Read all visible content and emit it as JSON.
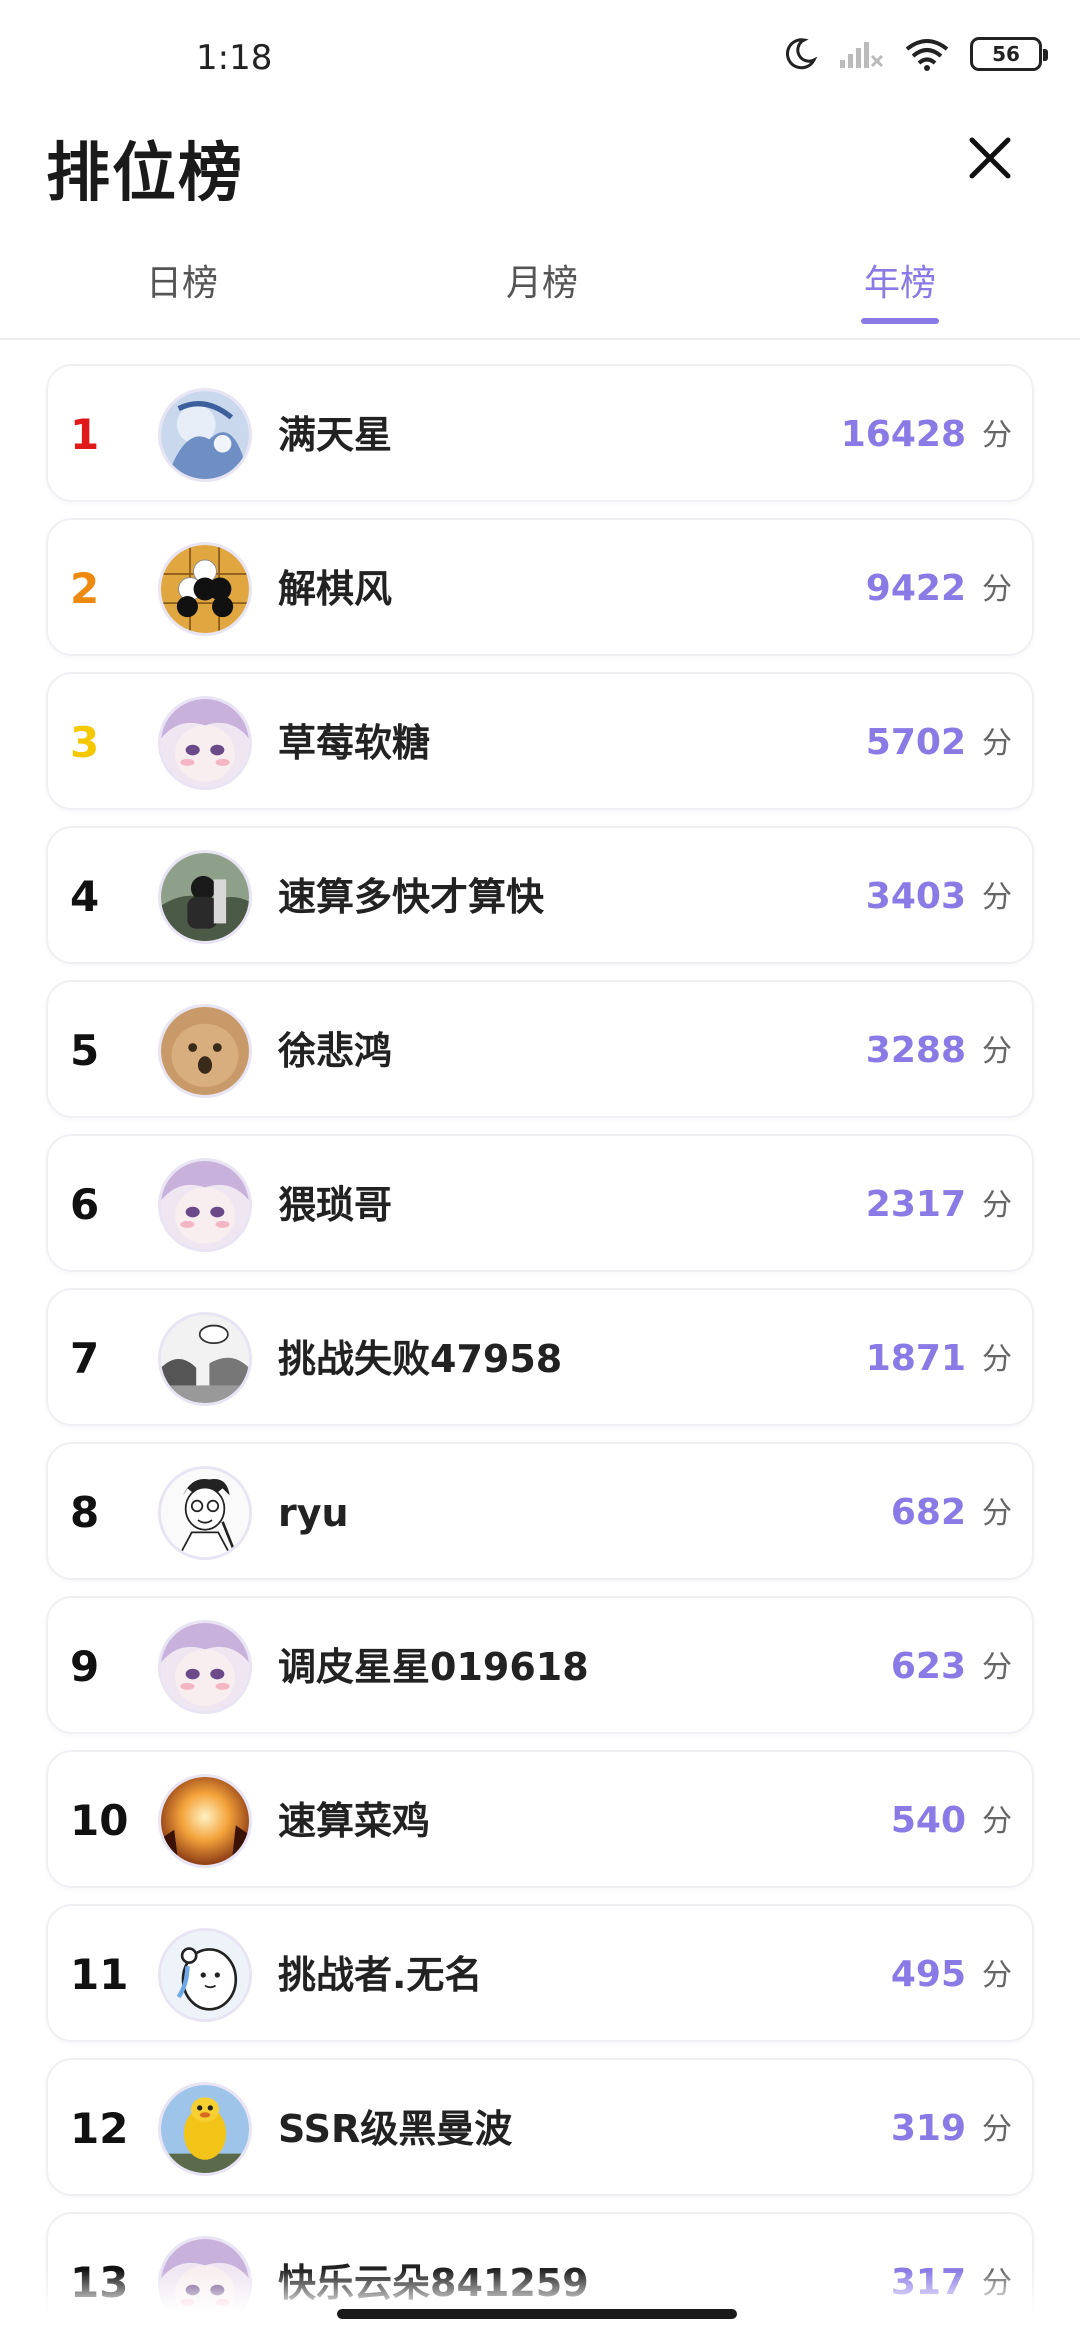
{
  "status_bar": {
    "time": "1:18",
    "battery": "56",
    "icons": [
      "moon-icon",
      "signal-icon",
      "wifi-icon",
      "battery-icon"
    ]
  },
  "header": {
    "title": "排位榜",
    "close_icon": "close-icon"
  },
  "tabs": [
    {
      "label": "日榜",
      "active": false
    },
    {
      "label": "月榜",
      "active": false
    },
    {
      "label": "年榜",
      "active": true
    }
  ],
  "colors": {
    "accent": "#8a7ae6",
    "rank1": "#e01a1a",
    "rank2": "#ee8a10",
    "rank3": "#f5c800"
  },
  "unit_label": "分",
  "leaderboard": [
    {
      "rank": "1",
      "name": "满天星",
      "score": "16428",
      "avatar": "anime-blue-avatar"
    },
    {
      "rank": "2",
      "name": "解棋风",
      "score": "9422",
      "avatar": "go-stones-avatar"
    },
    {
      "rank": "3",
      "name": "草莓软糖",
      "score": "5702",
      "avatar": "anime-pink-avatar"
    },
    {
      "rank": "4",
      "name": "速算多快才算快",
      "score": "3403",
      "avatar": "photo-dark-avatar"
    },
    {
      "rank": "5",
      "name": "徐悲鸿",
      "score": "3288",
      "avatar": "cat-avatar"
    },
    {
      "rank": "6",
      "name": "猥琐哥",
      "score": "2317",
      "avatar": "anime-pink-avatar"
    },
    {
      "rank": "7",
      "name": "挑战失败47958",
      "score": "1871",
      "avatar": "comic-avatar"
    },
    {
      "rank": "8",
      "name": "ryu",
      "score": "682",
      "avatar": "sketch-man-avatar"
    },
    {
      "rank": "9",
      "name": "调皮星星019618",
      "score": "623",
      "avatar": "anime-pink-avatar"
    },
    {
      "rank": "10",
      "name": "速算菜鸡",
      "score": "540",
      "avatar": "sunset-avatar"
    },
    {
      "rank": "11",
      "name": "挑战者.无名",
      "score": "495",
      "avatar": "cartoon-bear-avatar"
    },
    {
      "rank": "12",
      "name": "SSR级黑曼波",
      "score": "319",
      "avatar": "yellow-balloon-avatar"
    },
    {
      "rank": "13",
      "name": "快乐云朵841259",
      "score": "317",
      "avatar": "anime-pink-avatar"
    }
  ]
}
